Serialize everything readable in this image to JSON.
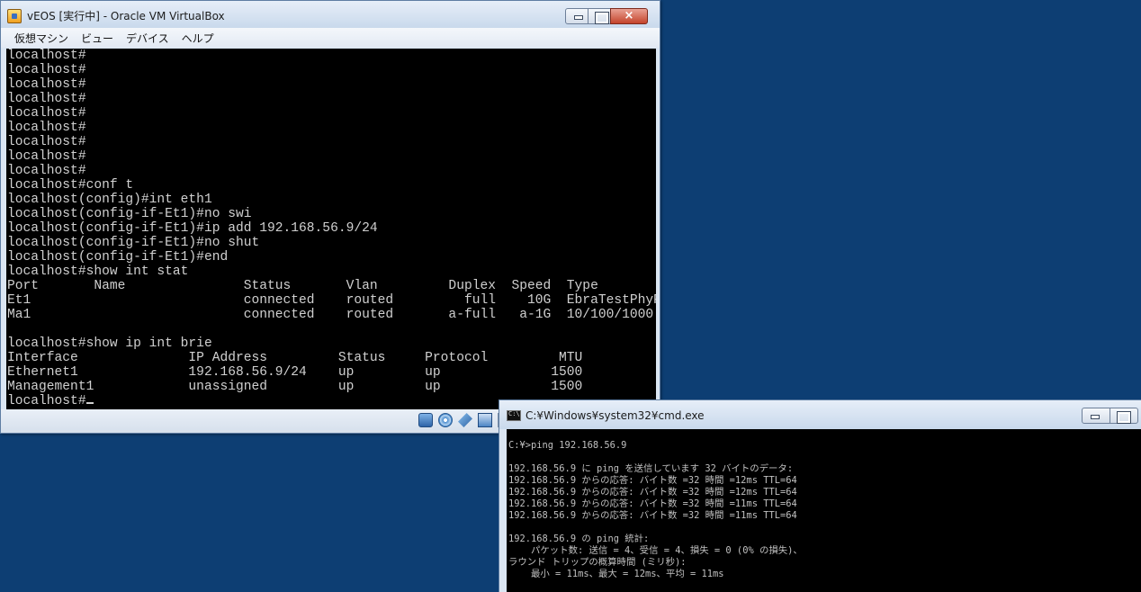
{
  "desktop": {
    "background_color": "#0d3e73"
  },
  "vbox_window": {
    "title": "vEOS [実行中] - Oracle VM VirtualBox",
    "menu": [
      "仮想マシン",
      "ビュー",
      "デバイス",
      "ヘルプ"
    ],
    "console_lines": [
      "localhost#",
      "localhost#",
      "localhost#",
      "localhost#",
      "localhost#",
      "localhost#",
      "localhost#",
      "localhost#",
      "localhost#",
      "localhost#conf t",
      "localhost(config)#int eth1",
      "localhost(config-if-Et1)#no swi",
      "localhost(config-if-Et1)#ip add 192.168.56.9/24",
      "localhost(config-if-Et1)#no shut",
      "localhost(config-if-Et1)#end",
      "localhost#show int stat",
      "Port       Name               Status       Vlan         Duplex  Speed  Type",
      "Et1                           connected    routed         full    10G  EbraTestPhyP",
      "Ma1                           connected    routed       a-full   a-1G  10/100/1000",
      "",
      "localhost#show ip int brie",
      "Interface              IP Address         Status     Protocol         MTU",
      "Ethernet1              192.168.56.9/24    up         up              1500",
      "Management1            unassigned         up         up              1500",
      "localhost#"
    ],
    "status_icons": [
      "hard-disk-icon",
      "optical-disc-icon",
      "usb-icon",
      "network-icon",
      "shared-folder-icon"
    ]
  },
  "cmd_window": {
    "title": "C:¥Windows¥system32¥cmd.exe",
    "console_lines": [
      "C:¥>ping 192.168.56.9",
      "",
      "192.168.56.9 に ping を送信しています 32 バイトのデータ:",
      "192.168.56.9 からの応答: バイト数 =32 時間 =12ms TTL=64",
      "192.168.56.9 からの応答: バイト数 =32 時間 =12ms TTL=64",
      "192.168.56.9 からの応答: バイト数 =32 時間 =11ms TTL=64",
      "192.168.56.9 からの応答: バイト数 =32 時間 =11ms TTL=64",
      "",
      "192.168.56.9 の ping 統計:",
      "    パケット数: 送信 = 4、受信 = 4、損失 = 0 (0% の損失)、",
      "ラウンド トリップの概算時間 (ミリ秒):",
      "    最小 = 11ms、最大 = 12ms、平均 = 11ms"
    ]
  }
}
